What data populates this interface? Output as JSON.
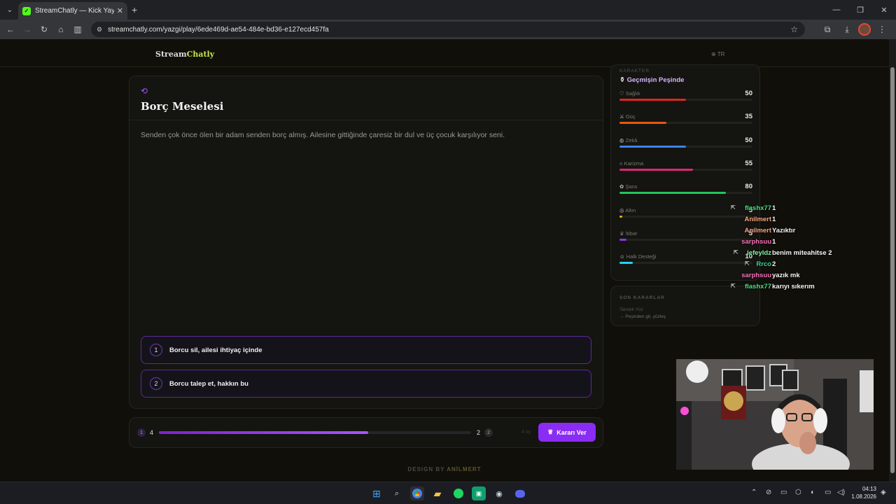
{
  "browser": {
    "tab_title": "StreamChatly — Kick Yayıncıları",
    "url": "streamchatly.com/yazgi/play/6ede469d-ae54-484e-bd36-e127ecd457fa"
  },
  "header": {
    "logo_part1": "Stream",
    "logo_part2": "Chatly",
    "lang": "TR"
  },
  "story": {
    "title": "Borç Meselesi",
    "text": "Senden çok önce ölen bir adam senden borç almış. Ailesine gittiğinde çaresiz bir dul ve üç çocuk karşılıyor seni.",
    "choices": [
      {
        "num": "1",
        "label": "Borcu sil, ailesi ihtiyaç içinde"
      },
      {
        "num": "2",
        "label": "Borcu talep et, hakkın bu"
      }
    ]
  },
  "vote": {
    "left_index": "1",
    "left_votes": "4",
    "right_votes": "2",
    "right_index": "2",
    "progress": 0.67,
    "hint": "4 oy",
    "button": "Kararı Ver"
  },
  "footer": {
    "prefix": "DESIGN BY",
    "author": "ANİLMERT"
  },
  "sidebar": {
    "kicker": "KARAKTER",
    "character": "Geçmişin Peşinde",
    "stats": [
      {
        "label": "Sağlık",
        "value": "50",
        "fill": 0.5,
        "color": "#dc2626",
        "icon": "heart-icon",
        "glyph": "♡"
      },
      {
        "label": "Güç",
        "value": "35",
        "fill": 0.35,
        "color": "#ea580c",
        "icon": "sword-icon",
        "glyph": "⚔"
      },
      {
        "label": "Zekâ",
        "value": "50",
        "fill": 0.5,
        "color": "#3b82f6",
        "icon": "brain-icon",
        "glyph": "◍"
      },
      {
        "label": "Karizma",
        "value": "55",
        "fill": 0.55,
        "color": "#db2777",
        "icon": "chat-icon",
        "glyph": "○"
      },
      {
        "label": "Şans",
        "value": "80",
        "fill": 0.8,
        "color": "#22c55e",
        "icon": "clover-icon",
        "glyph": "✿"
      },
      {
        "label": "Altın",
        "value": "5",
        "fill": 0.02,
        "color": "#eab308",
        "icon": "coins-icon",
        "glyph": "◎"
      },
      {
        "label": "İtibar",
        "value": "5",
        "fill": 0.05,
        "color": "#9333ea",
        "icon": "crown-icon",
        "glyph": "♕"
      },
      {
        "label": "Halk Desteği",
        "value": "10",
        "fill": 0.1,
        "color": "#22d3ee",
        "icon": "people-icon",
        "glyph": "☺"
      }
    ]
  },
  "recent": {
    "title": "SON KARARLAR",
    "item_meta": "Tanıdık Yüz",
    "item_choice": "→ Peşinden git, yüzleş"
  },
  "chat": [
    {
      "user": "flashx77",
      "msg": "1",
      "color": "#4ade80",
      "badge": "k"
    },
    {
      "user": "Anilmert",
      "msg": "1",
      "color": "#f4a482",
      "badge": ""
    },
    {
      "user": "Anilmert",
      "msg": "Yazıktır",
      "color": "#f4a482",
      "badge": ""
    },
    {
      "user": "sarphsuu",
      "msg": "1",
      "color": "#f472b6",
      "badge": ""
    },
    {
      "user": "iefeyldz",
      "msg": "benim miteahitse 2",
      "color": "#86efac",
      "badge": "k"
    },
    {
      "user": "Rrco",
      "msg": "2",
      "color": "#34d399",
      "badge": "k"
    },
    {
      "user": "sarphsuu",
      "msg": "yazık mk",
      "color": "#f472b6",
      "badge": ""
    },
    {
      "user": "flashx77",
      "msg": "karıyı sıkerım",
      "color": "#4ade80",
      "badge": "k"
    }
  ],
  "taskbar": {
    "time": "04:13",
    "date": "1.08.2026"
  }
}
